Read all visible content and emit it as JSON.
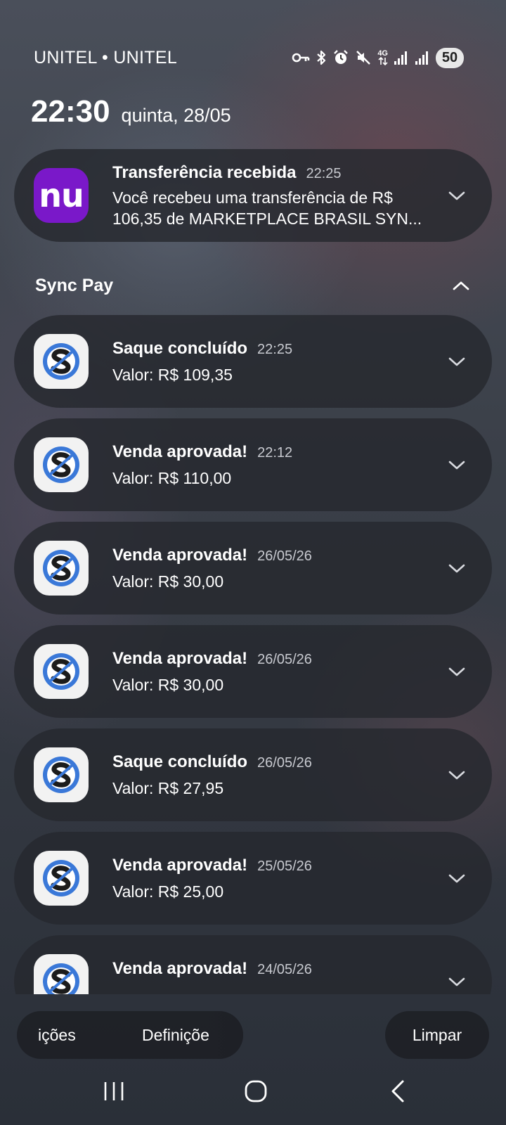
{
  "status_bar": {
    "carrier": "UNITEL • UNITEL",
    "network": "4G",
    "battery": "50"
  },
  "lockscreen": {
    "time": "22:30",
    "date": "quinta, 28/05"
  },
  "nubank_notification": {
    "title": "Transferência recebida",
    "time": "22:25",
    "body_line1": "Você recebeu uma transferência de R$",
    "body_line2": "106,35 de MARKETPLACE BRASIL SYN...",
    "icon_text": "nu",
    "icon_color": "#7a18c9"
  },
  "group": {
    "title": "Sync Pay",
    "items": [
      {
        "title": "Saque concluído",
        "time": "22:25",
        "body": "Valor: R$ 109,35"
      },
      {
        "title": "Venda aprovada!",
        "time": "22:12",
        "body": "Valor: R$ 110,00"
      },
      {
        "title": "Venda aprovada!",
        "time": "26/05/26",
        "body": "Valor: R$ 30,00"
      },
      {
        "title": "Venda aprovada!",
        "time": "26/05/26",
        "body": "Valor: R$ 30,00"
      },
      {
        "title": "Saque concluído",
        "time": "26/05/26",
        "body": "Valor: R$ 27,95"
      },
      {
        "title": "Venda aprovada!",
        "time": "25/05/26",
        "body": "Valor: R$ 25,00"
      },
      {
        "title": "Venda aprovada!",
        "time": "24/05/26",
        "body": ""
      }
    ]
  },
  "actions": {
    "notification_settings_partial": "ições",
    "settings_partial": "Definiçõe",
    "clear": "Limpar"
  },
  "colors": {
    "card_bg": "#26282e",
    "sync_blue": "#3a78d8"
  }
}
